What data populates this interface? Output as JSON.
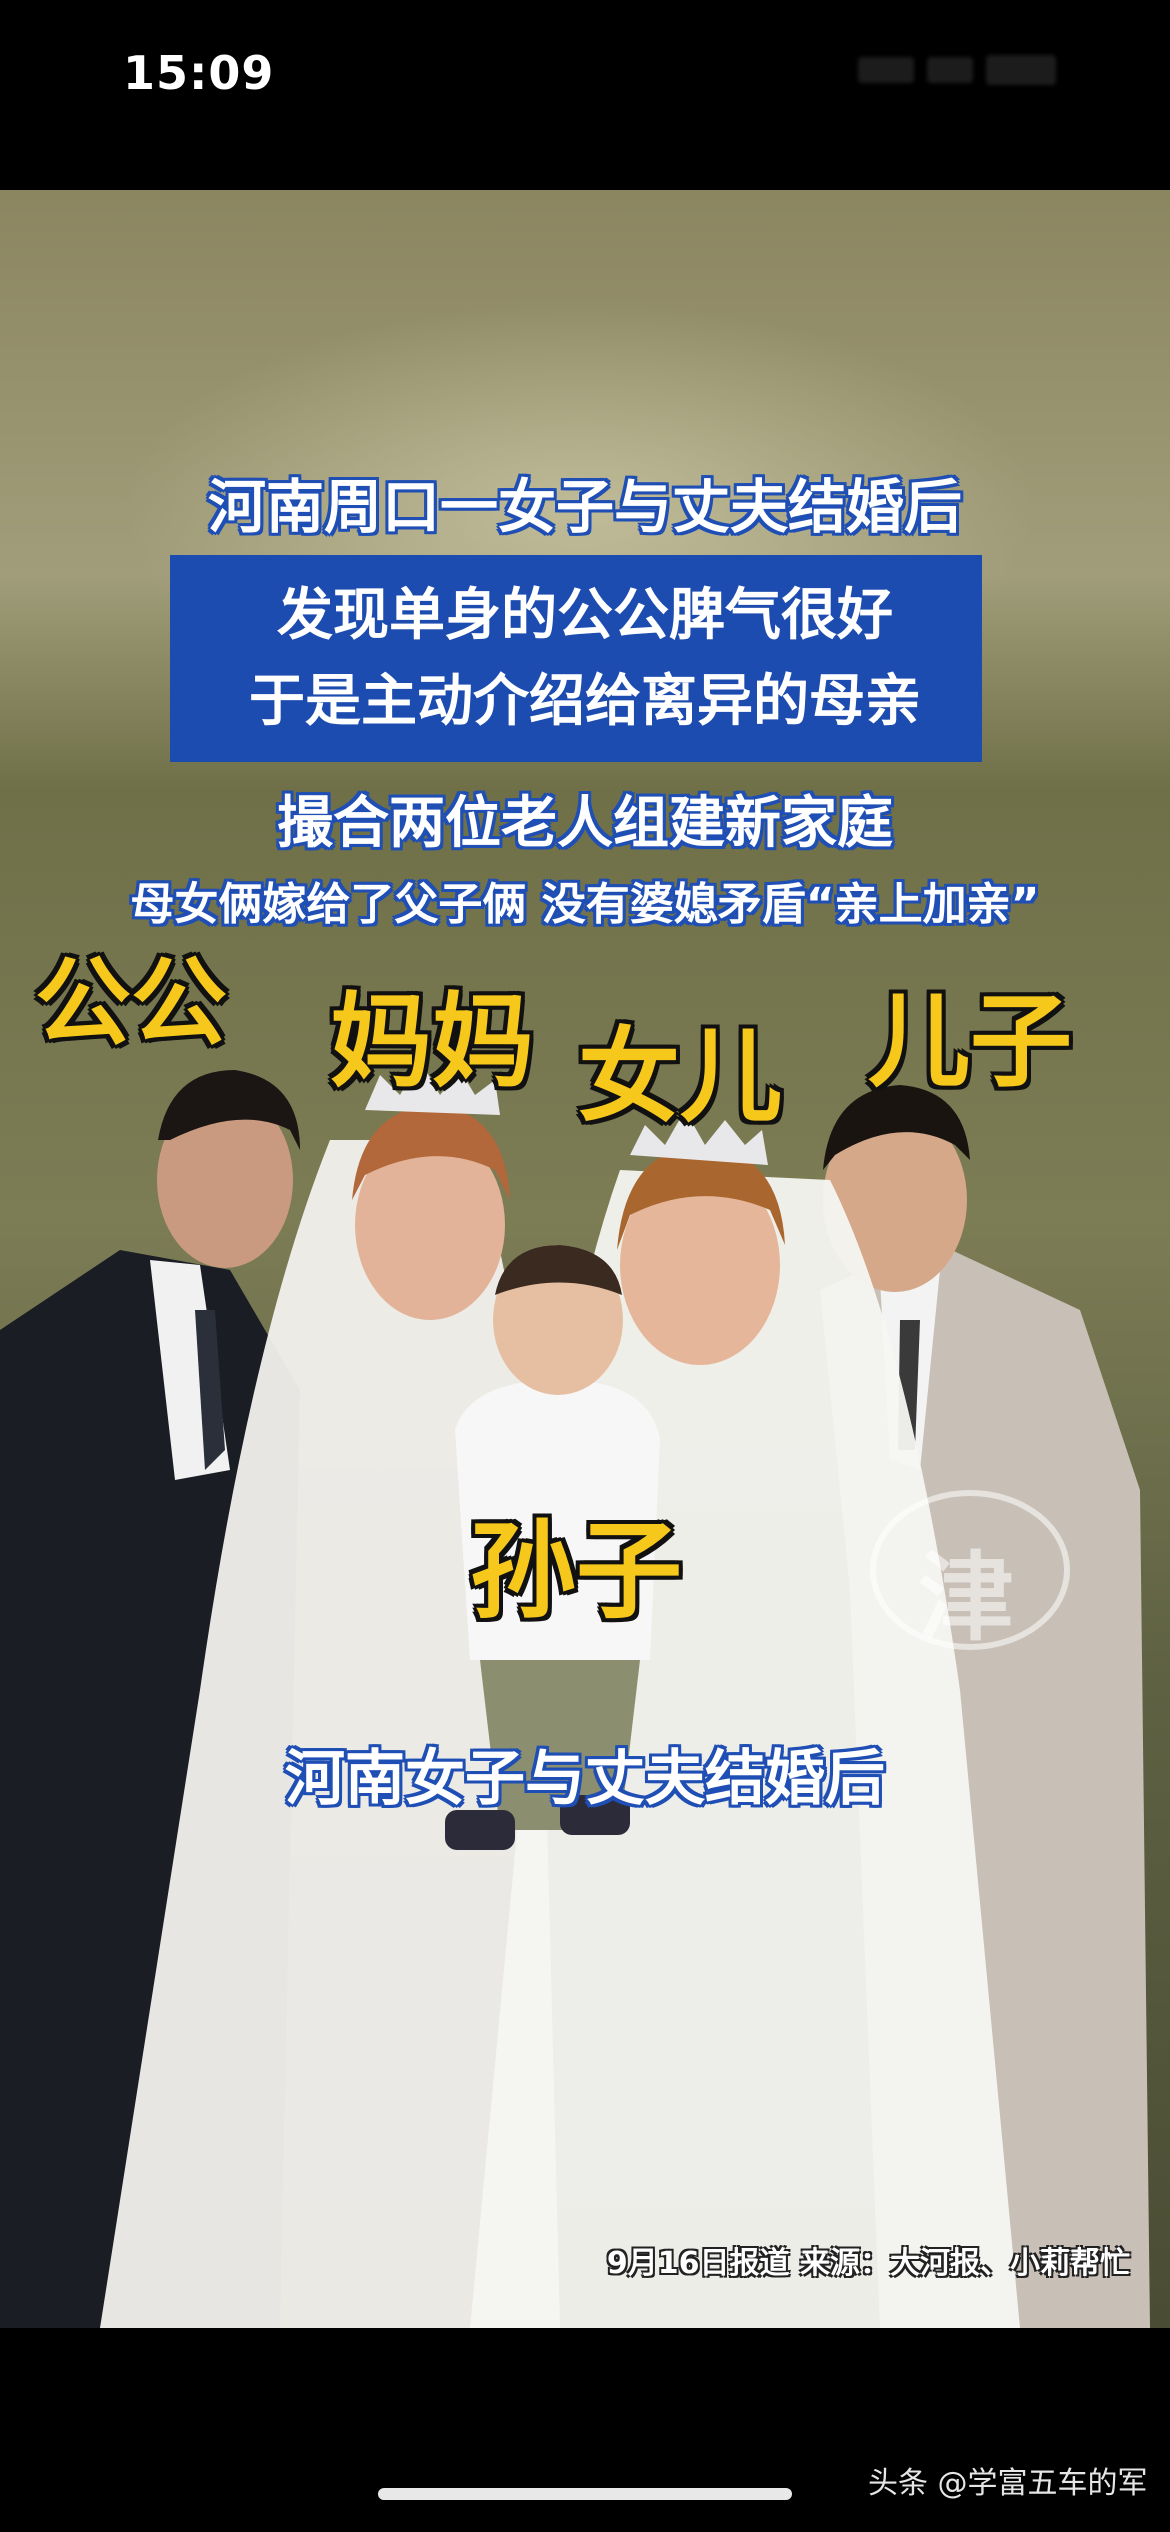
{
  "status_bar": {
    "time": "15:09"
  },
  "video": {
    "headline": "河南周口一女子与丈夫结婚后",
    "blue_box_line1": "发现单身的公公脾气很好",
    "blue_box_line2": "于是主动介绍给离异的母亲",
    "line3": "撮合两位老人组建新家庭",
    "line4": "母女俩嫁给了父子俩 没有婆媳矛盾“亲上加亲”",
    "labels": {
      "father_in_law": "公公",
      "mother": "妈妈",
      "daughter": "女儿",
      "son": "儿子",
      "grandson": "孙子"
    },
    "bottom_caption": "河南女子与丈夫结婚后",
    "source": "9月16日报道 来源：大河报、小莉帮忙",
    "station_logo_char": "津"
  },
  "app_watermark": "头条 @学富五车的军",
  "colors": {
    "caption_blue": "#1d4cb0",
    "label_yellow": "#f6c81c",
    "background": "#000000"
  }
}
